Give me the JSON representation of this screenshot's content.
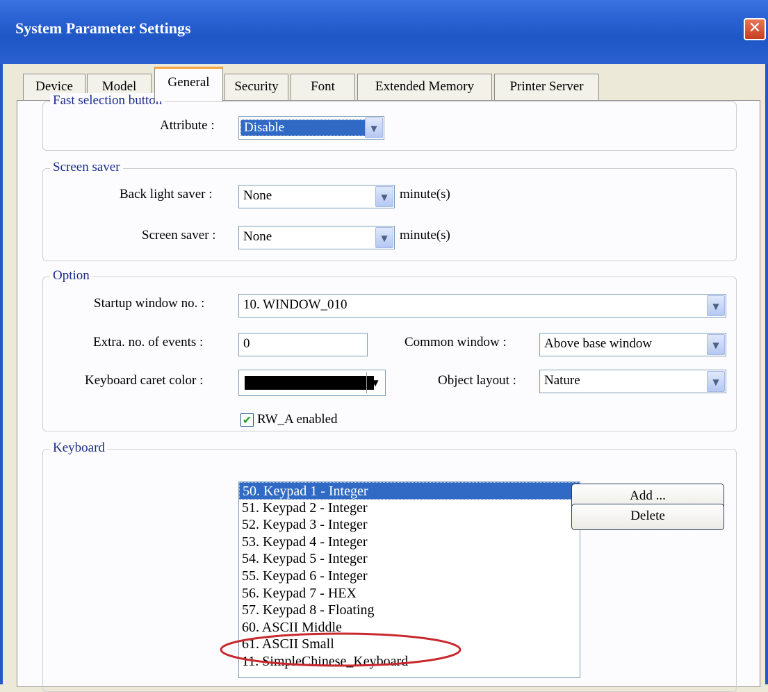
{
  "window": {
    "title": "System Parameter Settings",
    "close_glyph": "✕"
  },
  "tabs": [
    {
      "label": "Device"
    },
    {
      "label": "Model"
    },
    {
      "label": "General",
      "active": true
    },
    {
      "label": "Security"
    },
    {
      "label": "Font"
    },
    {
      "label": "Extended Memory"
    },
    {
      "label": "Printer Server"
    }
  ],
  "fast_selection": {
    "legend": "Fast selection button",
    "attribute_label": "Attribute :",
    "attribute_value": "Disable"
  },
  "screen_saver": {
    "legend": "Screen saver",
    "backlight_label": "Back light saver :",
    "backlight_value": "None",
    "backlight_unit": "minute(s)",
    "screensaver_label": "Screen saver :",
    "screensaver_value": "None",
    "screensaver_unit": "minute(s)"
  },
  "option": {
    "legend": "Option",
    "startup_label": "Startup window no. :",
    "startup_value": "10. WINDOW_010",
    "events_label": "Extra. no. of events :",
    "events_value": "0",
    "common_label": "Common window :",
    "common_value": "Above base window",
    "caret_label": "Keyboard caret color :",
    "caret_color": "#000000",
    "layout_label": "Object layout :",
    "layout_value": "Nature",
    "rw_label": "RW_A enabled",
    "rw_checked": true
  },
  "keyboard": {
    "legend": "Keyboard",
    "items": [
      "50. Keypad 1 - Integer",
      "51. Keypad 2 - Integer",
      "52. Keypad 3 - Integer",
      "53. Keypad 4 - Integer",
      "54. Keypad 5 - Integer",
      "55. Keypad 6 - Integer",
      "56. Keypad 7 - HEX",
      "57. Keypad 8 - Floating",
      "60. ASCII Middle",
      "61. ASCII Small",
      "11. SimpleChinese_Keyboard"
    ],
    "selected_index": 0,
    "highlighted_index": 10,
    "add_label": "Add ...",
    "delete_label": "Delete"
  },
  "colors": {
    "titlebar": "#2a62d3",
    "selection": "#316ac5",
    "annotation": "#c8282e",
    "legend": "#1b2b8a"
  }
}
